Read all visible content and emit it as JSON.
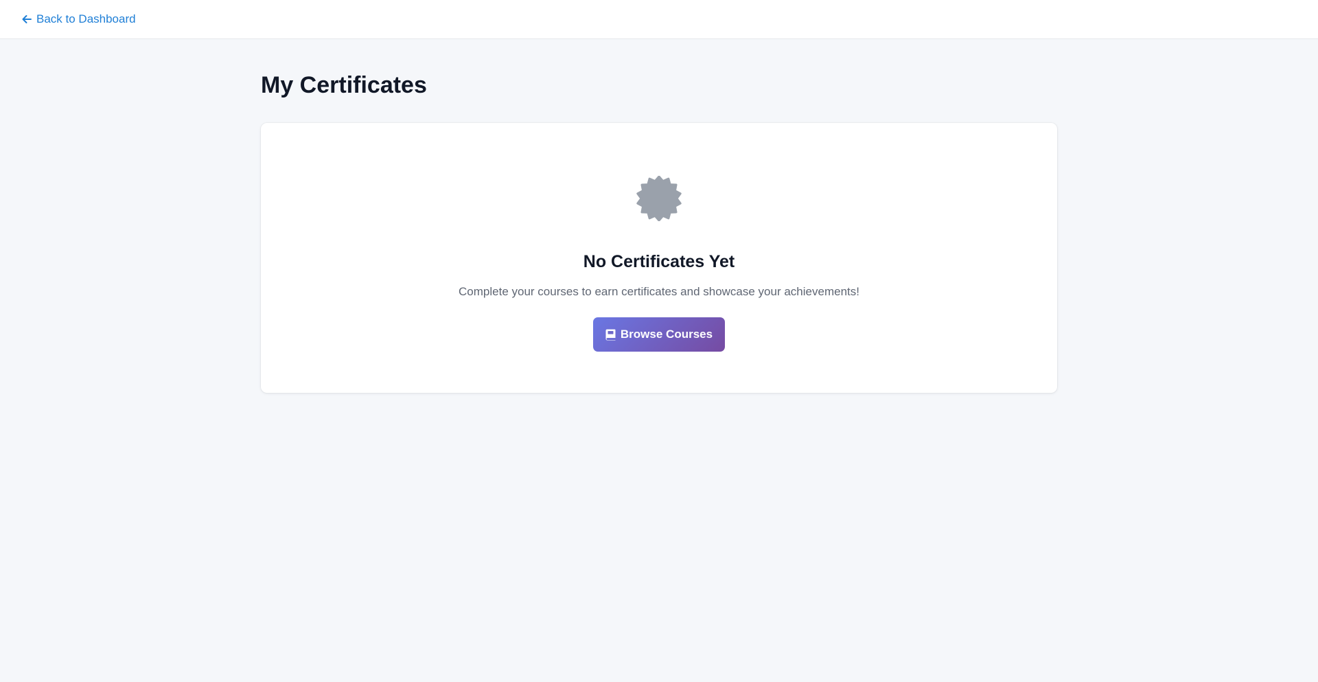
{
  "topbar": {
    "back_label": "Back to Dashboard",
    "back_icon": "arrow-left-icon"
  },
  "page": {
    "title": "My Certificates"
  },
  "empty_state": {
    "icon": "certificate-badge-icon",
    "title": "No Certificates Yet",
    "description": "Complete your courses to earn certificates and showcase your achievements!",
    "button_label": "Browse Courses",
    "button_icon": "book-icon"
  },
  "colors": {
    "link": "#1f7fd6",
    "background": "#f5f7fa",
    "icon_gray": "#9aa1ab",
    "button_gradient_start": "#6a77e3",
    "button_gradient_end": "#764ba2"
  }
}
